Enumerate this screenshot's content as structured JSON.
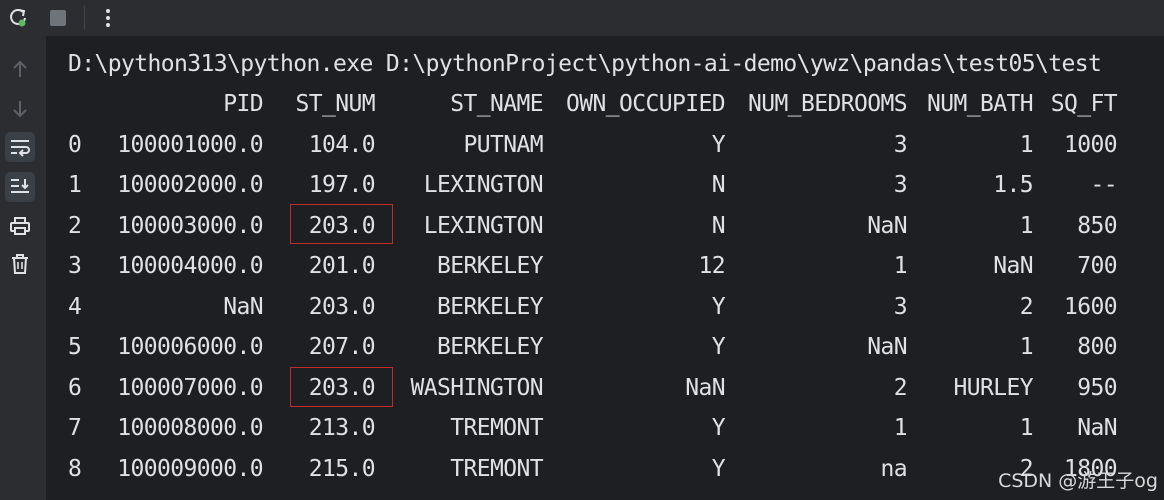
{
  "command_line": "D:\\python313\\python.exe D:\\pythonProject\\python-ai-demo\\ywz\\pandas\\test05\\test",
  "columns": [
    "PID",
    "ST_NUM",
    "ST_NAME",
    "OWN_OCCUPIED",
    "NUM_BEDROOMS",
    "NUM_BATH",
    "SQ_FT"
  ],
  "rows": [
    {
      "index": "0",
      "cells": [
        "100001000.0",
        "104.0",
        "PUTNAM",
        "Y",
        "3",
        "1",
        "1000"
      ]
    },
    {
      "index": "1",
      "cells": [
        "100002000.0",
        "197.0",
        "LEXINGTON",
        "N",
        "3",
        "1.5",
        "--"
      ]
    },
    {
      "index": "2",
      "cells": [
        "100003000.0",
        "203.0",
        "LEXINGTON",
        "N",
        "NaN",
        "1",
        "850"
      ]
    },
    {
      "index": "3",
      "cells": [
        "100004000.0",
        "201.0",
        "BERKELEY",
        "12",
        "1",
        "NaN",
        "700"
      ]
    },
    {
      "index": "4",
      "cells": [
        "NaN",
        "203.0",
        "BERKELEY",
        "Y",
        "3",
        "2",
        "1600"
      ]
    },
    {
      "index": "5",
      "cells": [
        "100006000.0",
        "207.0",
        "BERKELEY",
        "Y",
        "NaN",
        "1",
        "800"
      ]
    },
    {
      "index": "6",
      "cells": [
        "100007000.0",
        "203.0",
        "WASHINGTON",
        "NaN",
        "2",
        "HURLEY",
        "950"
      ]
    },
    {
      "index": "7",
      "cells": [
        "100008000.0",
        "213.0",
        "TREMONT",
        "Y",
        "1",
        "1",
        "NaN"
      ]
    },
    {
      "index": "8",
      "cells": [
        "100009000.0",
        "215.0",
        "TREMONT",
        "Y",
        "na",
        "2",
        "1800"
      ]
    }
  ],
  "highlighted_cells": [
    {
      "row": 2,
      "column": "ST_NUM",
      "value": "203.0"
    },
    {
      "row": 6,
      "column": "ST_NUM",
      "value": "203.0"
    }
  ],
  "highlight_color": "#c42b2b",
  "watermark": "CSDN @游王子og",
  "toolbar": {
    "icons": [
      "rerun-icon",
      "stop-icon",
      "more-options-icon"
    ]
  },
  "sidebar": {
    "icons": [
      "scroll-up-icon",
      "scroll-down-icon",
      "soft-wrap-icon",
      "scroll-to-end-icon",
      "print-icon",
      "clear-icon"
    ]
  },
  "colors": {
    "background": "#1e1f22",
    "panel": "#2b2d30",
    "text": "#dfe1e5",
    "rerun_green": "#5fb865"
  }
}
